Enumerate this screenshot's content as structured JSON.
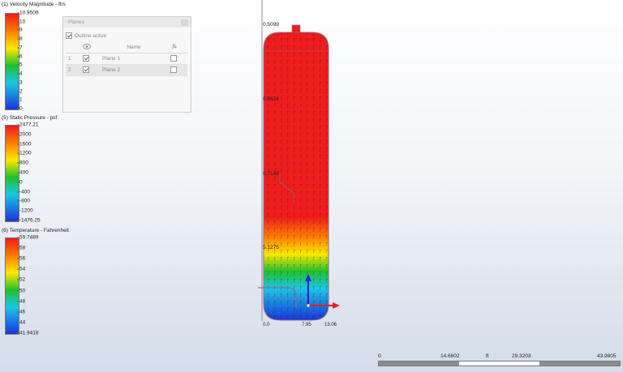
{
  "legends": {
    "velocity": {
      "title": "(1) Velocity Magnitude - ft/s",
      "ticks": [
        "10.9509",
        "10",
        "9",
        "8",
        "7",
        "6",
        "5",
        "4",
        "3",
        "2",
        "1",
        "0"
      ]
    },
    "pressure": {
      "title": "(5) Static Pressure - psf",
      "ticks": [
        "2477.21",
        "2000",
        "1600",
        "1200",
        "800",
        "400",
        "0",
        "-400",
        "-800",
        "-1200",
        "-1476.25"
      ]
    },
    "temperature": {
      "title": "(6) Temperature - Fahrenheit",
      "ticks": [
        "59.7489",
        "58",
        "56",
        "54",
        "52",
        "50",
        "48",
        "46",
        "44",
        "41.9418"
      ]
    }
  },
  "planes_panel": {
    "title": "Planes",
    "outline_label": "Outline active",
    "outline_checked": true,
    "columns": {
      "name": "Name"
    },
    "rows": [
      {
        "index": "1",
        "visible": true,
        "name": "Plane 1",
        "flag": false
      },
      {
        "index": "2",
        "visible": true,
        "name": "Plane 2",
        "flag": false
      }
    ]
  },
  "ruler_labels": {
    "top": "0.5099",
    "r2": "0.8624",
    "r3": "0.7148",
    "r4": "5.1275",
    "bottom_left": "0.0",
    "bottom_mid": "7.95",
    "bottom_right": "13.06"
  },
  "scalebar": {
    "labels": [
      "0",
      "14.6602",
      "ft",
      "29.3203",
      "43.9805"
    ]
  },
  "colors": {
    "red": "#ee1c1c",
    "orange": "#ff7a00",
    "yellow": "#ffe800",
    "green": "#22c02a",
    "cyan": "#19c6e6",
    "blue": "#1a35d8",
    "axis_red": "#e02020",
    "axis_blue": "#1a2ad0"
  }
}
